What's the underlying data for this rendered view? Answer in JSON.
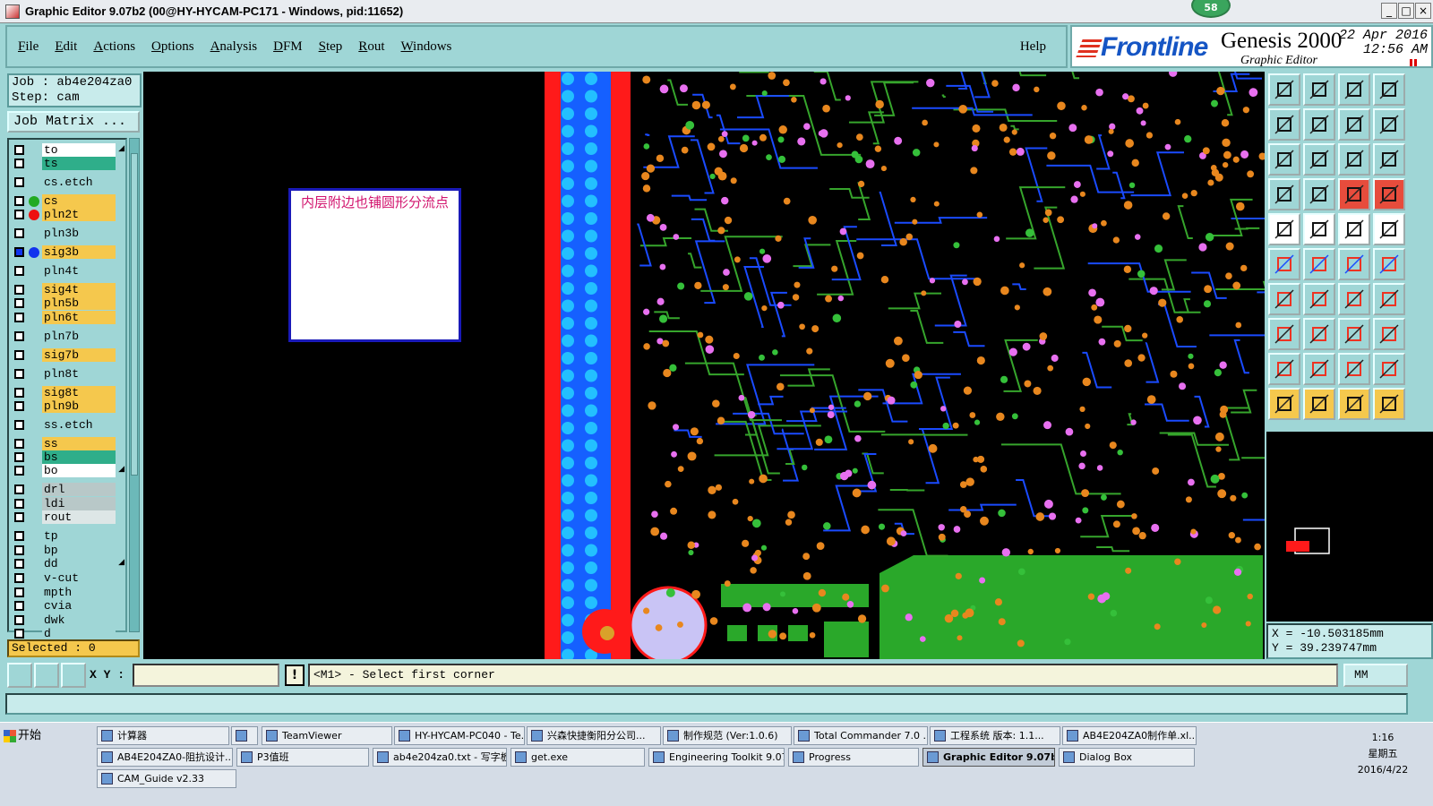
{
  "window": {
    "title": "Graphic Editor 9.07b2 (00@HY-HYCAM-PC171 - Windows, pid:11652)",
    "badge": "58"
  },
  "menu": {
    "items": [
      "File",
      "Edit",
      "Actions",
      "Options",
      "Analysis",
      "DFM",
      "Step",
      "Rout",
      "Windows"
    ],
    "help": "Help"
  },
  "brand": {
    "logo": "Frontline",
    "product": "Genesis 2000",
    "subtitle": "Graphic Editor",
    "date": "22 Apr 2016",
    "time": "12:56 AM"
  },
  "job": {
    "job_line": "Job : ab4e204za0",
    "step_line": "Step: cam",
    "matrix_button": "Job Matrix ..."
  },
  "layers": [
    {
      "name": "to",
      "color": "#ffffff",
      "dot": null,
      "arrow": true
    },
    {
      "name": "ts",
      "color": "#2fae8a",
      "dot": null
    },
    {
      "name": "cs.etch",
      "color": "#9fd6d6",
      "dot": null
    },
    {
      "name": "cs",
      "color": "#f5c84d",
      "dot": "#22aa22"
    },
    {
      "name": "pln2t",
      "color": "#f5c84d",
      "dot": "#ee1111"
    },
    {
      "name": "pln3b",
      "color": "#9fd6d6",
      "dot": null
    },
    {
      "name": "sig3b",
      "color": "#f5c84d",
      "dot": "#1133ee",
      "active": true
    },
    {
      "name": "pln4t",
      "color": "#9fd6d6",
      "dot": null
    },
    {
      "name": "sig4t",
      "color": "#f5c84d",
      "dot": null
    },
    {
      "name": "pln5b",
      "color": "#f5c84d",
      "dot": null
    },
    {
      "name": "pln6t",
      "color": "#f5c84d",
      "dot": null
    },
    {
      "name": "pln7b",
      "color": "#9fd6d6",
      "dot": null
    },
    {
      "name": "sig7b",
      "color": "#f5c84d",
      "dot": null
    },
    {
      "name": "pln8t",
      "color": "#9fd6d6",
      "dot": null
    },
    {
      "name": "sig8t",
      "color": "#f5c84d",
      "dot": null
    },
    {
      "name": "pln9b",
      "color": "#f5c84d",
      "dot": null
    },
    {
      "name": "ss.etch",
      "color": "#9fd6d6",
      "dot": null
    },
    {
      "name": "ss",
      "color": "#f5c84d",
      "dot": null
    },
    {
      "name": "bs",
      "color": "#2fae8a",
      "dot": null
    },
    {
      "name": "bo",
      "color": "#ffffff",
      "dot": null,
      "arrow": true
    },
    {
      "name": "drl",
      "color": "#b8c8c8",
      "dot": null
    },
    {
      "name": "ldi",
      "color": "#b8c8c8",
      "dot": null
    },
    {
      "name": "rout",
      "color": "#dde6e6",
      "dot": null
    },
    {
      "name": "tp",
      "color": "#9fd6d6",
      "dot": null
    },
    {
      "name": "bp",
      "color": "#9fd6d6",
      "dot": null
    },
    {
      "name": "dd",
      "color": "#9fd6d6",
      "dot": null,
      "arrow": true
    },
    {
      "name": "v-cut",
      "color": "#9fd6d6",
      "dot": null
    },
    {
      "name": "mpth",
      "color": "#9fd6d6",
      "dot": null
    },
    {
      "name": "cvia",
      "color": "#9fd6d6",
      "dot": null
    },
    {
      "name": "dwk",
      "color": "#9fd6d6",
      "dot": null
    },
    {
      "name": "d",
      "color": "#9fd6d6",
      "dot": null
    }
  ],
  "selected": "Selected : 0",
  "canvas": {
    "note": "内层附边也铺圆形分流点"
  },
  "coords": {
    "x": "X = -10.503185mm",
    "y": "Y = 39.239747mm"
  },
  "bottom": {
    "xy_label": "X Y :",
    "xy_value": "",
    "prompt": "<M1> - Select first corner",
    "units": "MM"
  },
  "taskbar": {
    "start": "开始",
    "row1": [
      "计算器",
      "",
      "TeamViewer",
      "HY-HYCAM-PC040 - Te...",
      "兴森快捷衡阳分公司...",
      "制作规范 (Ver:1.0.6)",
      "Total Commander 7.0 ...",
      "工程系统  版本: 1.1...",
      "AB4E204ZA0制作单.xl..."
    ],
    "row2": [
      "AB4E204ZA0-阻抗设计...",
      "P3值班",
      "ab4e204za0.txt - 写字板",
      "get.exe",
      "Engineering Toolkit 9.07...",
      "Progress",
      "Graphic Editor 9.07b...",
      "Dialog Box"
    ],
    "row3": [
      "CAM_Guide v2.33"
    ],
    "clock_time": "1:16",
    "clock_day": "星期五",
    "clock_date": "2016/4/22"
  }
}
